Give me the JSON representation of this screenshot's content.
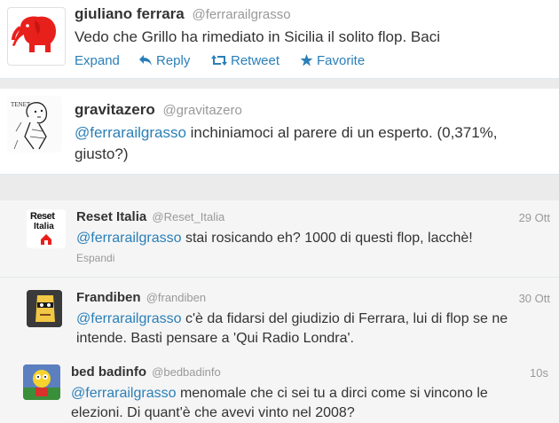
{
  "tweets": [
    {
      "name": "giuliano ferrara",
      "handle": "@ferrarailgrasso",
      "text": "Vedo che Grillo ha rimediato in Sicilia il solito flop. Baci",
      "actions": {
        "expand": "Expand",
        "reply": "Reply",
        "retweet": "Retweet",
        "favorite": "Favorite"
      }
    },
    {
      "name": "gravitazero",
      "handle": "@gravitazero",
      "mention": "@ferrarailgrasso",
      "text": " inchiniamoci al parere di un esperto. (0,371%, giusto?)"
    }
  ],
  "replies": [
    {
      "name": "Reset Italia",
      "handle": "@Reset_Italia",
      "time": "29 Ott",
      "mention": "@ferrarailgrasso",
      "text": " stai rosicando eh? 1000 di questi flop, lacchè!",
      "expand": "Espandi",
      "avatar_text_1": "Reset",
      "avatar_text_2": "Italia"
    },
    {
      "name": "Frandiben",
      "handle": "@frandiben",
      "time": "30 Ott",
      "mention": "@ferrarailgrasso",
      "text": " c'è da fidarsi del giudizio di Ferrara, lui di flop se ne intende. Basti pensare a 'Qui Radio Londra'."
    },
    {
      "name": "bed badinfo",
      "handle": "@bedbadinfo",
      "time": "10s",
      "mention": "@ferrarailgrasso",
      "text": " menomale che ci sei tu a dirci come si vincono le elezioni. Di quant'è che avevi vinto nel 2008?"
    }
  ],
  "colors": {
    "link": "#2a7fb8",
    "muted": "#999999",
    "elephant": "#e8201c"
  }
}
